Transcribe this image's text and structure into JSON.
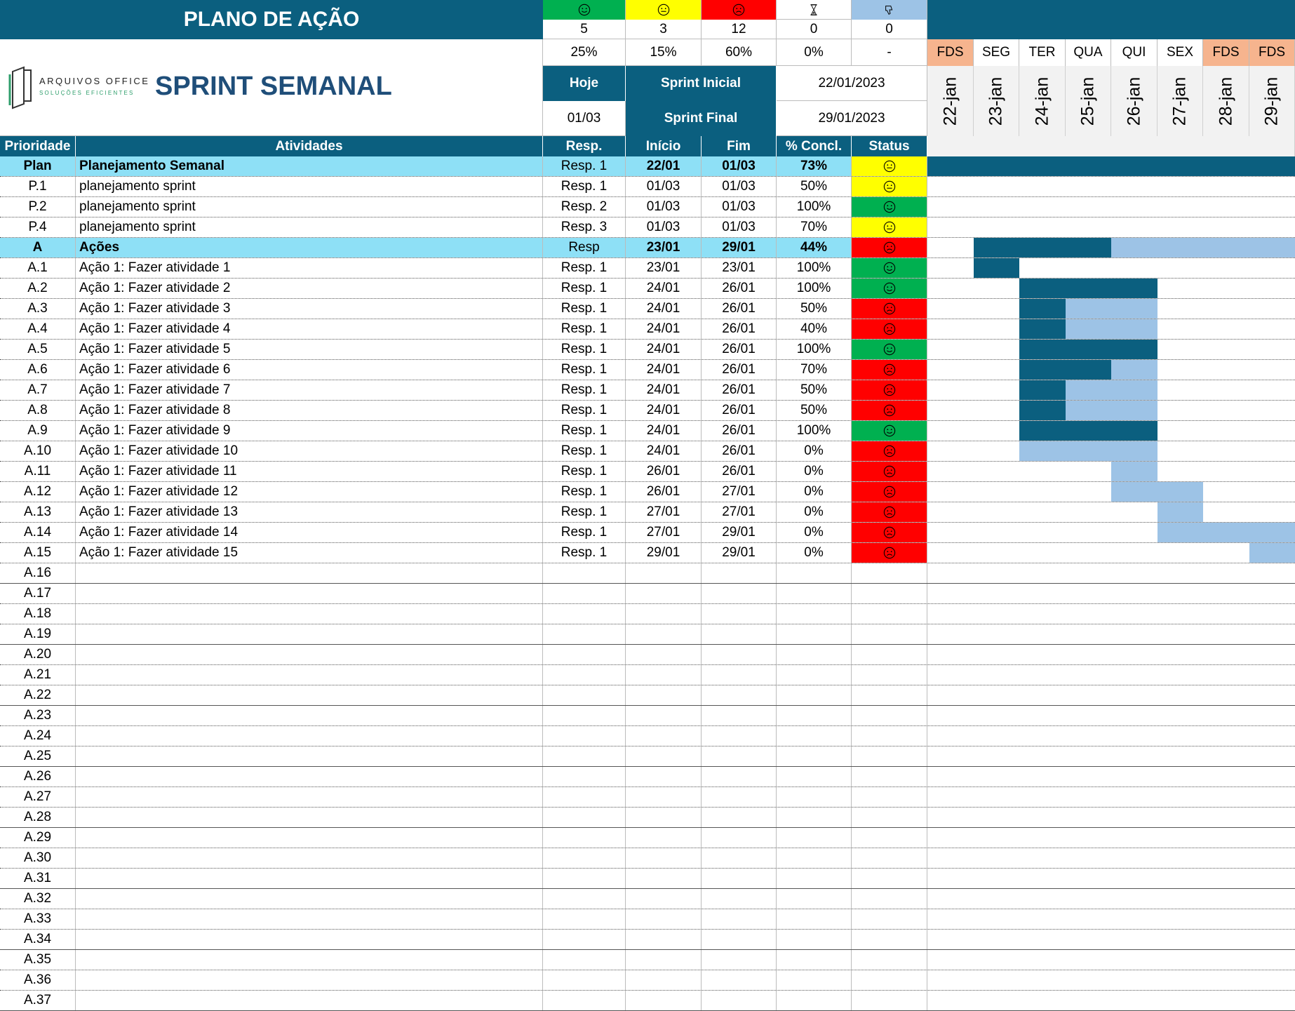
{
  "title": "PLANO DE AÇÃO",
  "logo": {
    "name": "ARQUIVOS OFFICE",
    "tagline": "SOLUÇÕES EFICIENTES"
  },
  "sprint_title": "SPRINT SEMANAL",
  "summary": {
    "counts": [
      {
        "icon": "happy-face-icon",
        "color": "#00b050",
        "count": "5",
        "pct": "25%"
      },
      {
        "icon": "neutral-face-icon",
        "color": "#ffff00",
        "count": "3",
        "pct": "15%"
      },
      {
        "icon": "sad-face-icon",
        "color": "#ff0000",
        "count": "12",
        "pct": "60%"
      },
      {
        "icon": "hourglass-icon",
        "color": "#ffffff",
        "count": "0",
        "pct": "0%"
      },
      {
        "icon": "thumbs-down-icon",
        "color": "#9dc3e6",
        "count": "0",
        "pct": "-"
      }
    ]
  },
  "info": {
    "hoje_label": "Hoje",
    "hoje_value": "01/03",
    "sprint_inicial_label": "Sprint Inicial",
    "sprint_inicial_value": "22/01/2023",
    "sprint_final_label": "Sprint Final",
    "sprint_final_value": "29/01/2023"
  },
  "calendar": {
    "days": [
      {
        "dow": "FDS",
        "date": "22-jan",
        "weekend": true
      },
      {
        "dow": "SEG",
        "date": "23-jan",
        "weekend": false
      },
      {
        "dow": "TER",
        "date": "24-jan",
        "weekend": false
      },
      {
        "dow": "QUA",
        "date": "25-jan",
        "weekend": false
      },
      {
        "dow": "QUI",
        "date": "26-jan",
        "weekend": false
      },
      {
        "dow": "SEX",
        "date": "27-jan",
        "weekend": false
      },
      {
        "dow": "FDS",
        "date": "28-jan",
        "weekend": true
      },
      {
        "dow": "FDS",
        "date": "29-jan",
        "weekend": true
      }
    ]
  },
  "columns": [
    "Prioridade",
    "Atividades",
    "Resp.",
    "Início",
    "Fim",
    "% Concl.",
    "Status"
  ],
  "colors": {
    "header": "#0b5f7f",
    "section": "#8ee0f6",
    "weekend": "#f6b48e",
    "gantt_done": "#0b5f7f",
    "gantt_remaining": "#9dc3e6",
    "status_ok": "#00b050",
    "status_mid": "#ffff00",
    "status_late": "#ff0000"
  },
  "rows": [
    {
      "id": "Plan",
      "activity": "Planejamento Semanal",
      "resp": "Resp. 1",
      "start": "22/01",
      "end": "01/03",
      "pct": "73%",
      "status": "neutral",
      "section": true,
      "gantt": [
        2,
        2,
        2,
        2,
        2,
        2,
        2,
        2
      ]
    },
    {
      "id": "P.1",
      "activity": "planejamento sprint",
      "resp": "Resp. 1",
      "start": "01/03",
      "end": "01/03",
      "pct": "50%",
      "status": "neutral",
      "gantt": [
        0,
        0,
        0,
        0,
        0,
        0,
        0,
        0
      ]
    },
    {
      "id": "P.2",
      "activity": "planejamento sprint",
      "resp": "Resp. 2",
      "start": "01/03",
      "end": "01/03",
      "pct": "100%",
      "status": "happy",
      "gantt": [
        0,
        0,
        0,
        0,
        0,
        0,
        0,
        0
      ]
    },
    {
      "id": "P.4",
      "activity": "planejamento sprint",
      "resp": "Resp. 3",
      "start": "01/03",
      "end": "01/03",
      "pct": "70%",
      "status": "neutral",
      "gantt": [
        0,
        0,
        0,
        0,
        0,
        0,
        0,
        0
      ]
    },
    {
      "id": "A",
      "activity": "Ações",
      "resp": "Resp",
      "start": "23/01",
      "end": "29/01",
      "pct": "44%",
      "status": "sad",
      "section": true,
      "gantt": [
        0,
        2,
        2,
        2,
        1,
        1,
        1,
        1
      ]
    },
    {
      "id": "A.1",
      "activity": "Ação 1: Fazer atividade 1",
      "resp": "Resp. 1",
      "start": "23/01",
      "end": "23/01",
      "pct": "100%",
      "status": "happy",
      "gantt": [
        0,
        2,
        0,
        0,
        0,
        0,
        0,
        0
      ]
    },
    {
      "id": "A.2",
      "activity": "Ação 1: Fazer atividade 2",
      "resp": "Resp. 1",
      "start": "24/01",
      "end": "26/01",
      "pct": "100%",
      "status": "happy",
      "gantt": [
        0,
        0,
        2,
        2,
        2,
        0,
        0,
        0
      ]
    },
    {
      "id": "A.3",
      "activity": "Ação 1: Fazer atividade 3",
      "resp": "Resp. 1",
      "start": "24/01",
      "end": "26/01",
      "pct": "50%",
      "status": "sad",
      "gantt": [
        0,
        0,
        2,
        1,
        1,
        0,
        0,
        0
      ]
    },
    {
      "id": "A.4",
      "activity": "Ação 1: Fazer atividade 4",
      "resp": "Resp. 1",
      "start": "24/01",
      "end": "26/01",
      "pct": "40%",
      "status": "sad",
      "gantt": [
        0,
        0,
        2,
        1,
        1,
        0,
        0,
        0
      ]
    },
    {
      "id": "A.5",
      "activity": "Ação 1: Fazer atividade 5",
      "resp": "Resp. 1",
      "start": "24/01",
      "end": "26/01",
      "pct": "100%",
      "status": "happy",
      "gantt": [
        0,
        0,
        2,
        2,
        2,
        0,
        0,
        0
      ]
    },
    {
      "id": "A.6",
      "activity": "Ação 1: Fazer atividade 6",
      "resp": "Resp. 1",
      "start": "24/01",
      "end": "26/01",
      "pct": "70%",
      "status": "sad",
      "gantt": [
        0,
        0,
        2,
        2,
        1,
        0,
        0,
        0
      ]
    },
    {
      "id": "A.7",
      "activity": "Ação 1: Fazer atividade 7",
      "resp": "Resp. 1",
      "start": "24/01",
      "end": "26/01",
      "pct": "50%",
      "status": "sad",
      "gantt": [
        0,
        0,
        2,
        1,
        1,
        0,
        0,
        0
      ]
    },
    {
      "id": "A.8",
      "activity": "Ação 1: Fazer atividade 8",
      "resp": "Resp. 1",
      "start": "24/01",
      "end": "26/01",
      "pct": "50%",
      "status": "sad",
      "gantt": [
        0,
        0,
        2,
        1,
        1,
        0,
        0,
        0
      ]
    },
    {
      "id": "A.9",
      "activity": "Ação 1: Fazer atividade 9",
      "resp": "Resp. 1",
      "start": "24/01",
      "end": "26/01",
      "pct": "100%",
      "status": "happy",
      "gantt": [
        0,
        0,
        2,
        2,
        2,
        0,
        0,
        0
      ]
    },
    {
      "id": "A.10",
      "activity": "Ação 1: Fazer atividade 10",
      "resp": "Resp. 1",
      "start": "24/01",
      "end": "26/01",
      "pct": "0%",
      "status": "sad",
      "gantt": [
        0,
        0,
        1,
        1,
        1,
        0,
        0,
        0
      ]
    },
    {
      "id": "A.11",
      "activity": "Ação 1: Fazer atividade 11",
      "resp": "Resp. 1",
      "start": "26/01",
      "end": "26/01",
      "pct": "0%",
      "status": "sad",
      "gantt": [
        0,
        0,
        0,
        0,
        1,
        0,
        0,
        0
      ]
    },
    {
      "id": "A.12",
      "activity": "Ação 1: Fazer atividade 12",
      "resp": "Resp. 1",
      "start": "26/01",
      "end": "27/01",
      "pct": "0%",
      "status": "sad",
      "gantt": [
        0,
        0,
        0,
        0,
        1,
        1,
        0,
        0
      ]
    },
    {
      "id": "A.13",
      "activity": "Ação 1: Fazer atividade 13",
      "resp": "Resp. 1",
      "start": "27/01",
      "end": "27/01",
      "pct": "0%",
      "status": "sad",
      "gantt": [
        0,
        0,
        0,
        0,
        0,
        1,
        0,
        0
      ]
    },
    {
      "id": "A.14",
      "activity": "Ação 1: Fazer atividade 14",
      "resp": "Resp. 1",
      "start": "27/01",
      "end": "29/01",
      "pct": "0%",
      "status": "sad",
      "gantt": [
        0,
        0,
        0,
        0,
        0,
        1,
        1,
        1
      ]
    },
    {
      "id": "A.15",
      "activity": "Ação 1: Fazer atividade 15",
      "resp": "Resp. 1",
      "start": "29/01",
      "end": "29/01",
      "pct": "0%",
      "status": "sad",
      "gantt": [
        0,
        0,
        0,
        0,
        0,
        0,
        0,
        1
      ]
    },
    {
      "id": "A.16"
    },
    {
      "id": "A.17"
    },
    {
      "id": "A.18"
    },
    {
      "id": "A.19"
    },
    {
      "id": "A.20"
    },
    {
      "id": "A.21"
    },
    {
      "id": "A.22"
    },
    {
      "id": "A.23"
    },
    {
      "id": "A.24"
    },
    {
      "id": "A.25"
    },
    {
      "id": "A.26"
    },
    {
      "id": "A.27"
    },
    {
      "id": "A.28"
    },
    {
      "id": "A.29"
    },
    {
      "id": "A.30"
    },
    {
      "id": "A.31"
    },
    {
      "id": "A.32"
    },
    {
      "id": "A.33"
    },
    {
      "id": "A.34"
    },
    {
      "id": "A.35"
    },
    {
      "id": "A.36"
    },
    {
      "id": "A.37"
    }
  ]
}
